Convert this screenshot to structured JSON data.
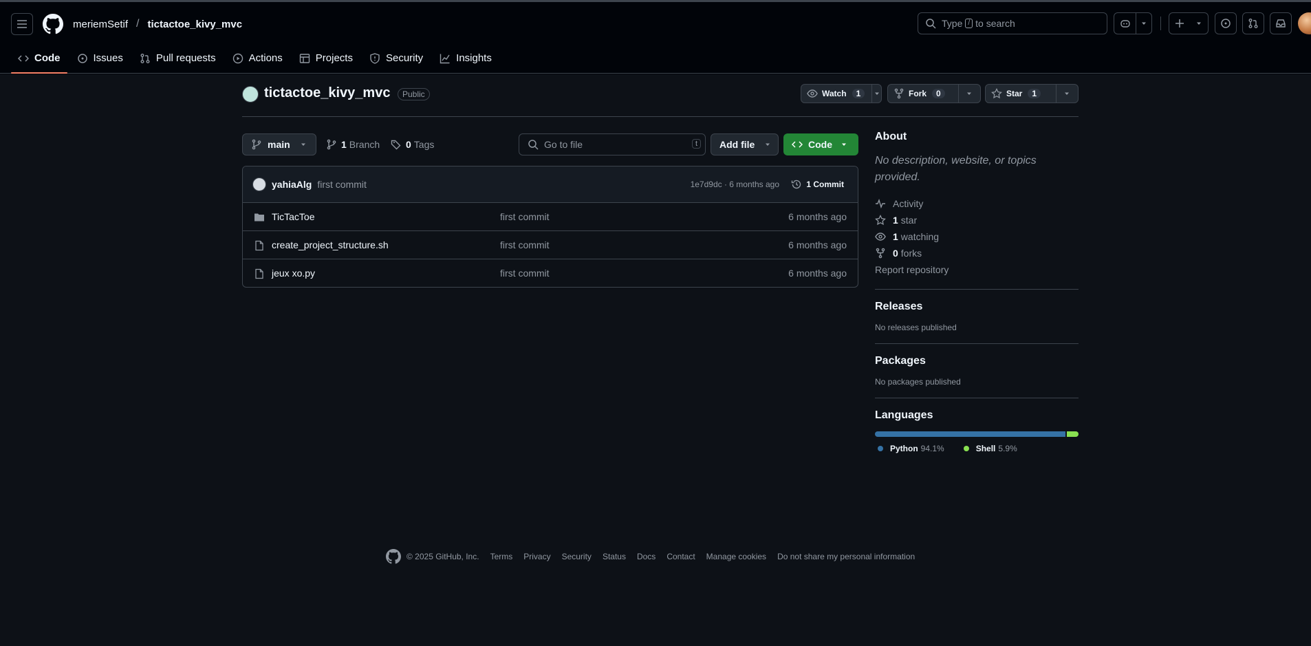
{
  "header": {
    "owner": "meriemSetif",
    "separator": "/",
    "repo": "tictactoe_kivy_mvc",
    "search_pre": "Type",
    "search_key": "/",
    "search_post": "to search"
  },
  "tabs": [
    {
      "label": "Code",
      "icon": "code-icon"
    },
    {
      "label": "Issues",
      "icon": "issue-icon"
    },
    {
      "label": "Pull requests",
      "icon": "pull-request-icon"
    },
    {
      "label": "Actions",
      "icon": "play-icon"
    },
    {
      "label": "Projects",
      "icon": "table-icon"
    },
    {
      "label": "Security",
      "icon": "shield-icon"
    },
    {
      "label": "Insights",
      "icon": "graph-icon"
    }
  ],
  "repo": {
    "name": "tictactoe_kivy_mvc",
    "visibility": "Public",
    "watch_label": "Watch",
    "watch_count": "1",
    "fork_label": "Fork",
    "fork_count": "0",
    "star_label": "Star",
    "star_count": "1"
  },
  "toolbar": {
    "branch": "main",
    "branches_count": "1",
    "branches_label": "Branch",
    "tags_count": "0",
    "tags_label": "Tags",
    "goto_placeholder": "Go to file",
    "goto_key": "t",
    "add_file": "Add file",
    "code": "Code"
  },
  "commit": {
    "author": "yahiaAlg",
    "message": "first commit",
    "sha_time": "1e7d9dc · 6 months ago",
    "count": "1 Commit"
  },
  "files": [
    {
      "name": "TicTacToe",
      "type": "folder",
      "message": "first commit",
      "time": "6 months ago"
    },
    {
      "name": "create_project_structure.sh",
      "type": "file",
      "message": "first commit",
      "time": "6 months ago"
    },
    {
      "name": "jeux xo.py",
      "type": "file",
      "message": "first commit",
      "time": "6 months ago"
    }
  ],
  "about": {
    "title": "About",
    "description": "No description, website, or topics provided.",
    "activity": "Activity",
    "stars_count": "1",
    "stars_label": "star",
    "watching_count": "1",
    "watching_label": "watching",
    "forks_count": "0",
    "forks_label": "forks",
    "report": "Report repository"
  },
  "releases": {
    "title": "Releases",
    "text": "No releases published"
  },
  "packages": {
    "title": "Packages",
    "text": "No packages published"
  },
  "languages": {
    "title": "Languages",
    "items": [
      {
        "name": "Python",
        "percent": "94.1%",
        "value": 94.1,
        "color": "#3572A5"
      },
      {
        "name": "Shell",
        "percent": "5.9%",
        "value": 5.9,
        "color": "#89e051"
      }
    ]
  },
  "footer": {
    "copyright": "© 2025 GitHub, Inc.",
    "links": [
      "Terms",
      "Privacy",
      "Security",
      "Status",
      "Docs",
      "Contact",
      "Manage cookies",
      "Do not share my personal information"
    ]
  }
}
